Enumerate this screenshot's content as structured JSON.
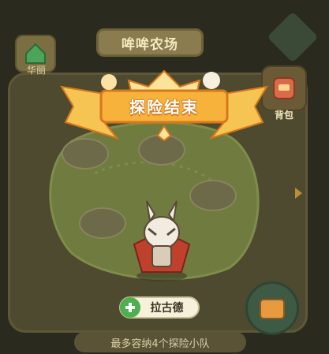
{
  "header": {
    "title": "哞哞农场"
  },
  "left_button": {
    "label": "华丽",
    "icon": "house-icon"
  },
  "right_button": {
    "label": "背包",
    "icon": "backpack-icon"
  },
  "result_banner": {
    "text": "探险结束"
  },
  "character": {
    "name": "拉古德",
    "badge_icon": "clover-plus-icon"
  },
  "footer": {
    "text": "最多容纳4个探险小队"
  },
  "colors": {
    "banner": "#f6c453",
    "banner_shadow": "#d7781a",
    "badge_green": "#4caf50"
  }
}
